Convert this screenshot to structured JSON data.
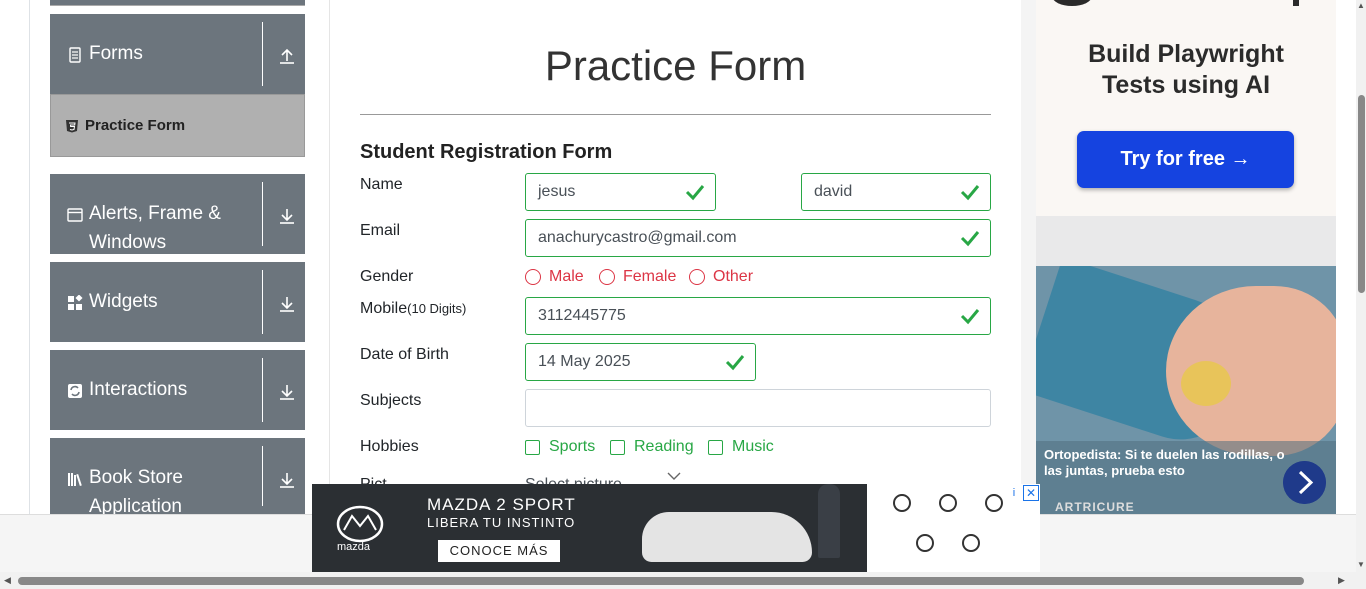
{
  "sidebar": {
    "groups": [
      {
        "label": "Forms",
        "icon": "forms-icon",
        "arrow": "collapse-up"
      },
      {
        "label": "Alerts, Frame & Windows",
        "icon": "window-icon",
        "arrow": "expand-down"
      },
      {
        "label": "Widgets",
        "icon": "widgets-icon",
        "arrow": "expand-down"
      },
      {
        "label": "Interactions",
        "icon": "interactions-icon",
        "arrow": "expand-down"
      },
      {
        "label": "Book Store Application",
        "icon": "books-icon",
        "arrow": "expand-down"
      }
    ],
    "active_item": "Practice Form"
  },
  "main": {
    "title": "Practice Form",
    "form_title": "Student Registration Form",
    "labels": {
      "name": "Name",
      "email": "Email",
      "gender": "Gender",
      "mobile": "Mobile",
      "mobile_hint": "(10 Digits)",
      "dob": "Date of Birth",
      "subjects": "Subjects",
      "hobbies": "Hobbies",
      "picture": "Pict..."
    },
    "fields": {
      "first_name": "jesus",
      "last_name": "david",
      "email": "anachurycastro@gmail.com",
      "mobile": "3112445775",
      "dob": "14 May 2025",
      "subjects": "",
      "select_hint": "Select picture..."
    },
    "gender_options": [
      "Male",
      "Female",
      "Other"
    ],
    "hobby_options": [
      "Sports",
      "Reading",
      "Music"
    ]
  },
  "ads": {
    "top": {
      "headline_line1": "Build Playwright",
      "headline_line2": "Tests using AI",
      "cta": "Try for free →"
    },
    "middle": {
      "caption": "Ortopedista: Si te duelen las rodillas, o las juntas, prueba esto",
      "brand": "ARTRICURE"
    },
    "bottom": {
      "brand": "mazda",
      "line1": "MAZDA 2 SPORT",
      "line2": "LIBERA TU INSTINTO",
      "cta": "CONOCE MÁS"
    }
  },
  "colors": {
    "sidebar_bg": "#6c757d",
    "active_bg": "#b0b0b0",
    "valid": "#28a745",
    "invalid": "#dc3545",
    "cta_blue": "#1543e0"
  }
}
